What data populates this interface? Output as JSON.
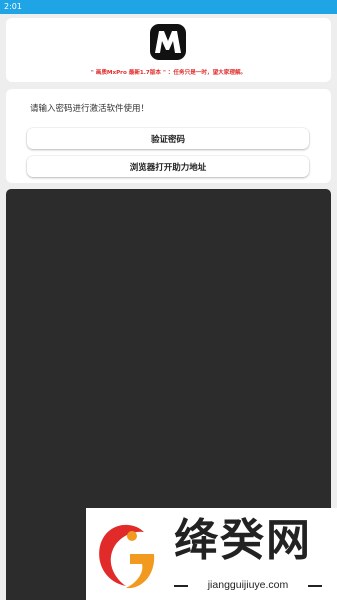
{
  "status_bar": {
    "time": "2:01"
  },
  "header": {
    "logo_text": "M",
    "notice": "\" 画质MxPro 最新1.7版本 \" ：任务只是一时，望大家理解。"
  },
  "form": {
    "prompt": "请输入密码进行激活软件使用！",
    "verify_button": "验证密码",
    "open_browser_button": "浏览器打开助力地址"
  },
  "watermark": {
    "title": "绛癸网",
    "domain": "jiangguijiuye.com"
  },
  "colors": {
    "status_bar": "#1fa5e6",
    "notice": "#e02a2a",
    "dark_panel": "#2c2c2c",
    "watermark_orange": "#f29a1f",
    "watermark_red": "#e12b2b"
  }
}
